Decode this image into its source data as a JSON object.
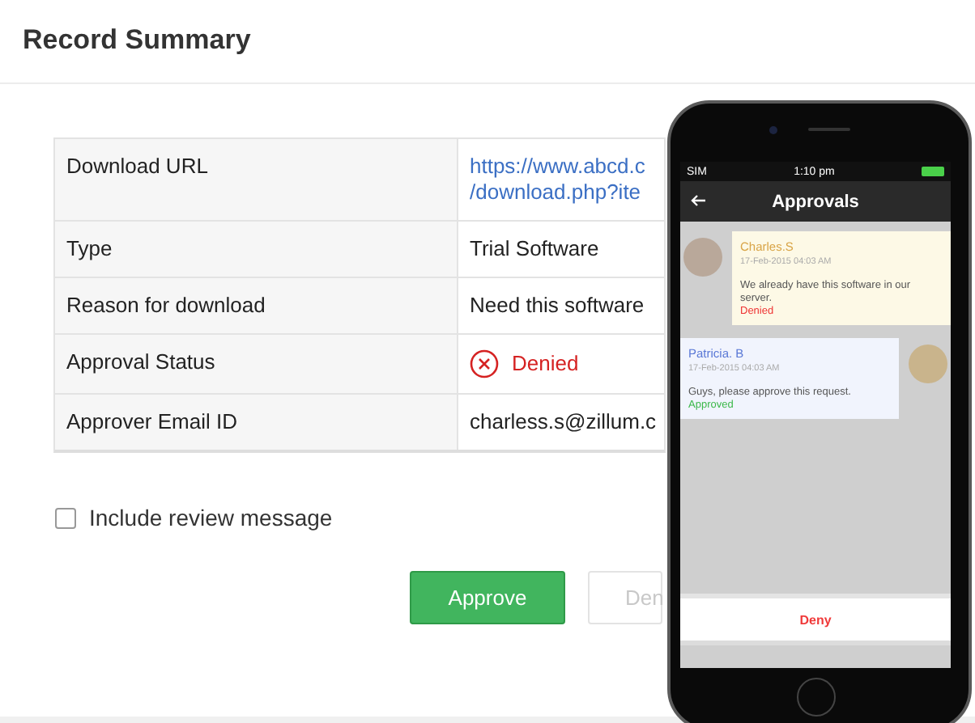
{
  "page": {
    "title": "Record Summary"
  },
  "details": {
    "rows": [
      {
        "label": "Download URL",
        "kind": "link",
        "lines": [
          "https://www.abcd.c",
          "/download.php?ite"
        ]
      },
      {
        "label": "Type",
        "kind": "text",
        "lines": [
          "Trial Software"
        ]
      },
      {
        "label": "Reason for download",
        "kind": "text",
        "lines": [
          "Need this software"
        ]
      },
      {
        "label": "Approval Status",
        "kind": "status",
        "lines": [
          "Denied"
        ]
      },
      {
        "label": "Approver Email ID",
        "kind": "text",
        "lines": [
          "charless.s@zillum.c"
        ]
      }
    ]
  },
  "review_option": {
    "label": "Include review message",
    "checked": false
  },
  "buttons": [
    {
      "label": "Approve",
      "kind": "primary"
    },
    {
      "label": "Den",
      "kind": "secondary"
    }
  ],
  "phone": {
    "carrier": "SIM",
    "time": "1:10 pm",
    "title": "Approvals",
    "messages": [
      {
        "author": "Charles.S",
        "date": "17-Feb-2015 04:03 AM",
        "text": "We already have this software in our server.",
        "status": "Denied",
        "color": "#ee3333",
        "kind": "incoming"
      },
      {
        "author": "Patricia. B",
        "date": "17-Feb-2015 04:03 AM",
        "text": "Guys, please approve this request.",
        "status": "Approved",
        "color": "#3cb84a",
        "kind": "outgoing"
      }
    ],
    "action": "Deny"
  }
}
